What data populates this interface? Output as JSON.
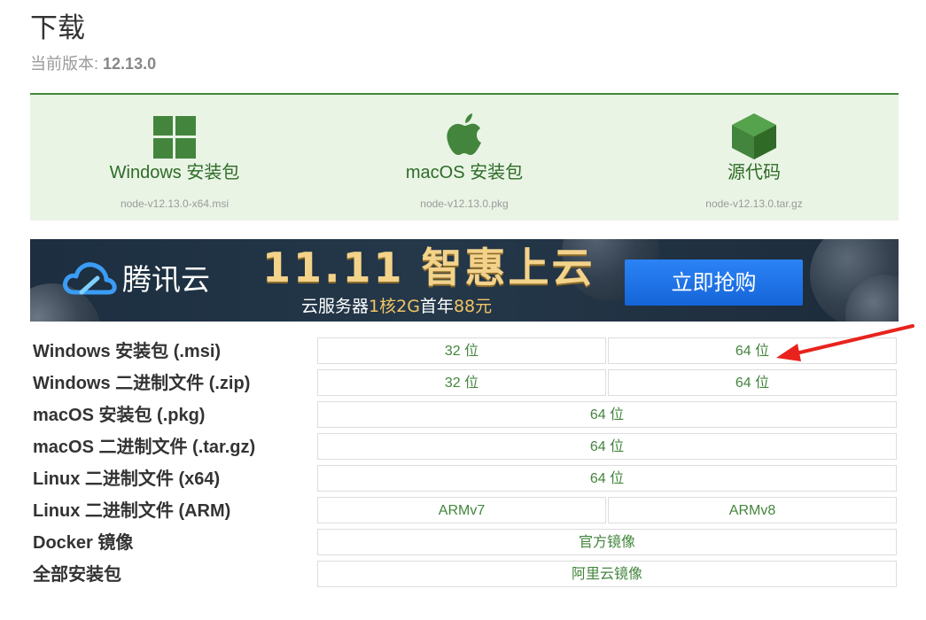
{
  "header": {
    "title": "下载",
    "version_label": "当前版本:",
    "version_number": "12.13.0"
  },
  "download_cards": [
    {
      "label": "Windows 安装包",
      "file": "node-v12.13.0-x64.msi",
      "icon": "windows-logo-icon"
    },
    {
      "label": "macOS 安装包",
      "file": "node-v12.13.0.pkg",
      "icon": "apple-logo-icon"
    },
    {
      "label": "源代码",
      "file": "node-v12.13.0.tar.gz",
      "icon": "cube-icon"
    }
  ],
  "banner": {
    "brand_name": "腾讯云",
    "promo_title": "11.11 智惠上云",
    "promo_sub_prefix": "云服务器",
    "promo_sub_highlight": "1核2G",
    "promo_sub_middle": "首年",
    "promo_sub_price": "88元",
    "cta_label": "立即抢购"
  },
  "downloads_table": [
    {
      "label": "Windows 安装包 (.msi)",
      "cells": [
        "32 位",
        "64 位"
      ]
    },
    {
      "label": "Windows 二进制文件 (.zip)",
      "cells": [
        "32 位",
        "64 位"
      ]
    },
    {
      "label": "macOS 安装包 (.pkg)",
      "cells": [
        "64 位"
      ]
    },
    {
      "label": "macOS 二进制文件 (.tar.gz)",
      "cells": [
        "64 位"
      ]
    },
    {
      "label": "Linux 二进制文件 (x64)",
      "cells": [
        "64 位"
      ]
    },
    {
      "label": "Linux 二进制文件 (ARM)",
      "cells": [
        "ARMv7",
        "ARMv8"
      ]
    },
    {
      "label": "Docker 镜像",
      "cells": [
        "官方镜像"
      ]
    },
    {
      "label": "全部安装包",
      "cells": [
        "阿里云镜像"
      ]
    }
  ],
  "colors": {
    "accent_green": "#43853d",
    "panel_bg": "#e9f4e5",
    "annotation_red": "#e8231d"
  }
}
